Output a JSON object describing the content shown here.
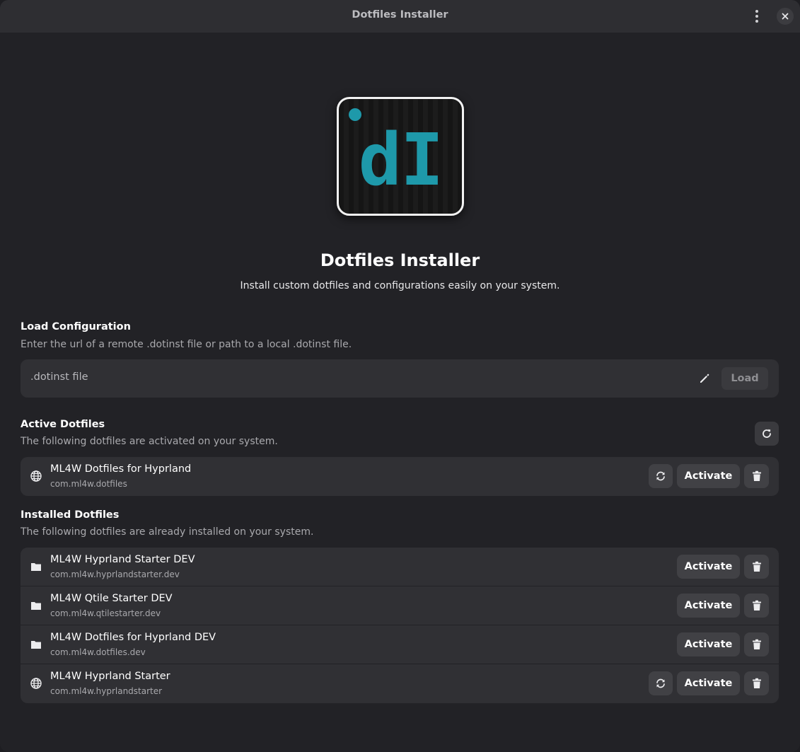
{
  "window": {
    "title": "Dotfiles Installer"
  },
  "app": {
    "logo_text": "dI",
    "title": "Dotfiles Installer",
    "subtitle": "Install custom dotfiles and configurations easily on your system."
  },
  "load": {
    "title": "Load Configuration",
    "description": "Enter the url of a remote .dotinst file or path to a local .dotinst file.",
    "placeholder": ".dotinst file",
    "value": "",
    "button_label": "Load"
  },
  "active": {
    "title": "Active Dotfiles",
    "description": "The following dotfiles are activated on your system.",
    "items": [
      {
        "name": "ML4W Dotfiles for Hyprland",
        "id": "com.ml4w.dotfiles",
        "icon": "globe-icon",
        "activate_label": "Activate"
      }
    ]
  },
  "installed": {
    "title": "Installed Dotfiles",
    "description": "The following dotfiles are already installed on your system.",
    "items": [
      {
        "name": "ML4W Hyprland Starter DEV",
        "id": "com.ml4w.hyprlandstarter.dev",
        "icon": "folder-icon",
        "activate_label": "Activate"
      },
      {
        "name": "ML4W Qtile Starter DEV",
        "id": "com.ml4w.qtilestarter.dev",
        "icon": "folder-icon",
        "activate_label": "Activate"
      },
      {
        "name": "ML4W Dotfiles for Hyprland DEV",
        "id": "com.ml4w.dotfiles.dev",
        "icon": "folder-icon",
        "activate_label": "Activate"
      },
      {
        "name": "ML4W Hyprland Starter",
        "id": "com.ml4w.hyprlandstarter",
        "icon": "globe-icon",
        "activate_label": "Activate"
      }
    ]
  },
  "colors": {
    "accent": "#1e99aa",
    "window_bg": "#222226",
    "row_bg": "#303034",
    "button_bg": "#414145"
  }
}
